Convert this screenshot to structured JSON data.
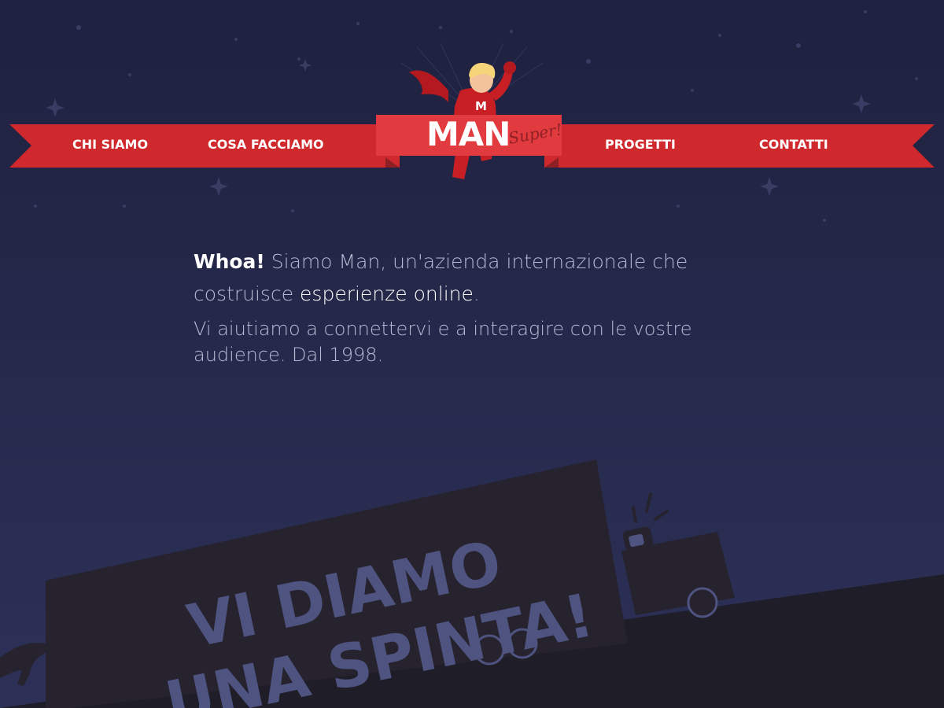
{
  "nav": {
    "items": [
      {
        "label": "CHI SIAMO"
      },
      {
        "label": "COSA FACCIAMO"
      },
      {
        "label": "PROGETTI"
      },
      {
        "label": "CONTATTI"
      }
    ]
  },
  "logo": {
    "word": "MAN",
    "tagline": "Super!",
    "chest_letter": "M"
  },
  "intro": {
    "whoa": "Whoa!",
    "lead_rest_1": " Siamo Man, un'azienda internazionale che costruisce ",
    "lead_highlight": "esperienze online",
    "lead_rest_2": ".",
    "sub": "Vi aiutiamo a connettervi e a interagire con le vostre audience. Dal 1998."
  },
  "truck": {
    "line1": "VI DIAMO",
    "line2": "UNA SPINTA!"
  },
  "colors": {
    "background": "#25284a",
    "ribbon": "#d0292d",
    "ribbon_dark": "#8e1f25",
    "truck": "#26232f",
    "truck_text": "#4e5380",
    "ground": "#1f1d28"
  }
}
